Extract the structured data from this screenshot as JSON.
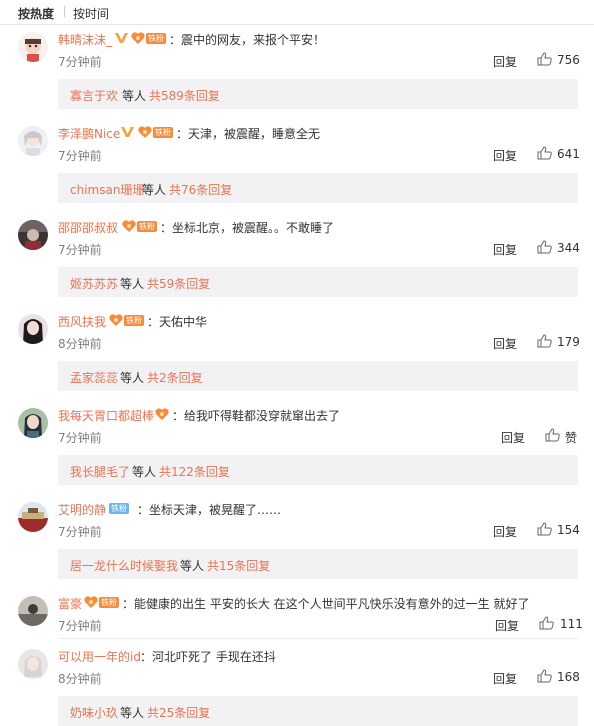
{
  "tabs": {
    "hot": "按热度",
    "time": "按时间"
  },
  "colors": {
    "accent": "#eb7350",
    "reply_bg": "#f2f2f5",
    "fan_badge": "#f78b39"
  },
  "reply_label": "回复",
  "comments": [
    {
      "name": "韩晴沫沫_",
      "verified": true,
      "badge": "铁粉",
      "text": "：震中的网友，来报个平安！",
      "time": "7分钟前",
      "likes": "756",
      "sub": {
        "name": "寡言于欢",
        "mid": "等人",
        "total": "共589条回复"
      }
    },
    {
      "name": "李泽鹏Nice",
      "verified": true,
      "badge": "铁粉",
      "text": "：天津，被震醒，睡意全无",
      "time": "7分钟前",
      "likes": "641",
      "sub": {
        "name": "chimsan珊珊",
        "mid": "等人",
        "total": "共76条回复"
      }
    },
    {
      "name": "邵邵邵叔叔",
      "verified": false,
      "badge": "铁粉",
      "text": "：坐标北京，被震醒。。不敢睡了",
      "time": "7分钟前",
      "likes": "344",
      "sub": {
        "name": "姬苏苏苏",
        "mid": "等人",
        "total": "共59条回复"
      }
    },
    {
      "name": "西风扶我",
      "verified": false,
      "badge": "铁粉",
      "text": "：天佑中华",
      "time": "8分钟前",
      "likes": "179",
      "sub": {
        "name": "孟家蕊蕊",
        "mid": "等人",
        "total": "共2条回复"
      }
    },
    {
      "name": "我每天胃口都超棒",
      "verified": false,
      "badge": "",
      "text": "：给我吓得鞋都没穿就窜出去了",
      "time": "7分钟前",
      "likes": "赞",
      "sub": {
        "name": "我长腿毛了",
        "mid": "等人",
        "total": "共122条回复"
      }
    },
    {
      "name": "艾明的静",
      "verified": false,
      "badge": "铁粉",
      "text": "：坐标天津，被晃醒了……",
      "time": "7分钟前",
      "likes": "154",
      "sub": {
        "name": "居一龙什么时候娶我",
        "mid": "等人",
        "total": "共15条回复"
      }
    },
    {
      "name": "富豪",
      "verified": false,
      "badge": "铁粉",
      "text": "：能健康的出生 平安的长大  在这个人世间平凡快乐没有意外的过一生 就好了",
      "time": "7分钟前",
      "likes": "111"
    },
    {
      "name": "可以用一年的id",
      "verified": false,
      "badge": "",
      "text": "：河北吓死了 手现在还抖",
      "time": "8分钟前",
      "likes": "168",
      "sub": {
        "name": "奶味小玖",
        "mid": "等人",
        "total": "共25条回复"
      }
    }
  ]
}
